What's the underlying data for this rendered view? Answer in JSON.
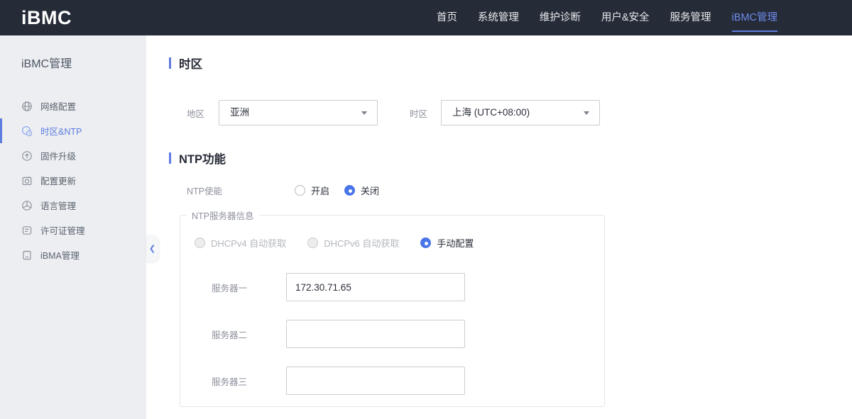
{
  "colors": {
    "accent": "#5e7ce0",
    "topbar_bg": "#262b38",
    "sidebar_bg": "#eceef1",
    "radio_selected": "#4a75e8"
  },
  "topbar": {
    "logo": "iBMC",
    "nav": [
      {
        "label": "首页"
      },
      {
        "label": "系统管理"
      },
      {
        "label": "维护诊断"
      },
      {
        "label": "用户&安全"
      },
      {
        "label": "服务管理"
      },
      {
        "label": "iBMC管理"
      }
    ]
  },
  "sidebar": {
    "title": "iBMC管理",
    "collapse_icon": "❮",
    "items": [
      {
        "label": "网络配置",
        "icon": "network-icon"
      },
      {
        "label": "时区&NTP",
        "icon": "timezone-ntp-icon"
      },
      {
        "label": "固件升级",
        "icon": "firmware-upgrade-icon"
      },
      {
        "label": "配置更新",
        "icon": "config-update-icon"
      },
      {
        "label": "语言管理",
        "icon": "language-icon"
      },
      {
        "label": "许可证管理",
        "icon": "license-icon"
      },
      {
        "label": "iBMA管理",
        "icon": "ibma-icon"
      }
    ]
  },
  "main": {
    "timezone_section": {
      "title": "时区",
      "region_label": "地区",
      "region_value": "亚洲",
      "tz_label": "时区",
      "tz_value": "上海 (UTC+08:00)"
    },
    "ntp_section": {
      "title": "NTP功能",
      "enable_label": "NTP使能",
      "enable_on": "开启",
      "enable_off": "关闭",
      "server_box": {
        "legend": "NTP服务器信息",
        "mode_dhcpv4": "DHCPv4 自动获取",
        "mode_dhcpv6": "DHCPv6 自动获取",
        "mode_manual": "手动配置",
        "servers": [
          {
            "label": "服务器一",
            "value": "172.30.71.65"
          },
          {
            "label": "服务器二",
            "value": ""
          },
          {
            "label": "服务器三",
            "value": ""
          }
        ]
      }
    }
  }
}
